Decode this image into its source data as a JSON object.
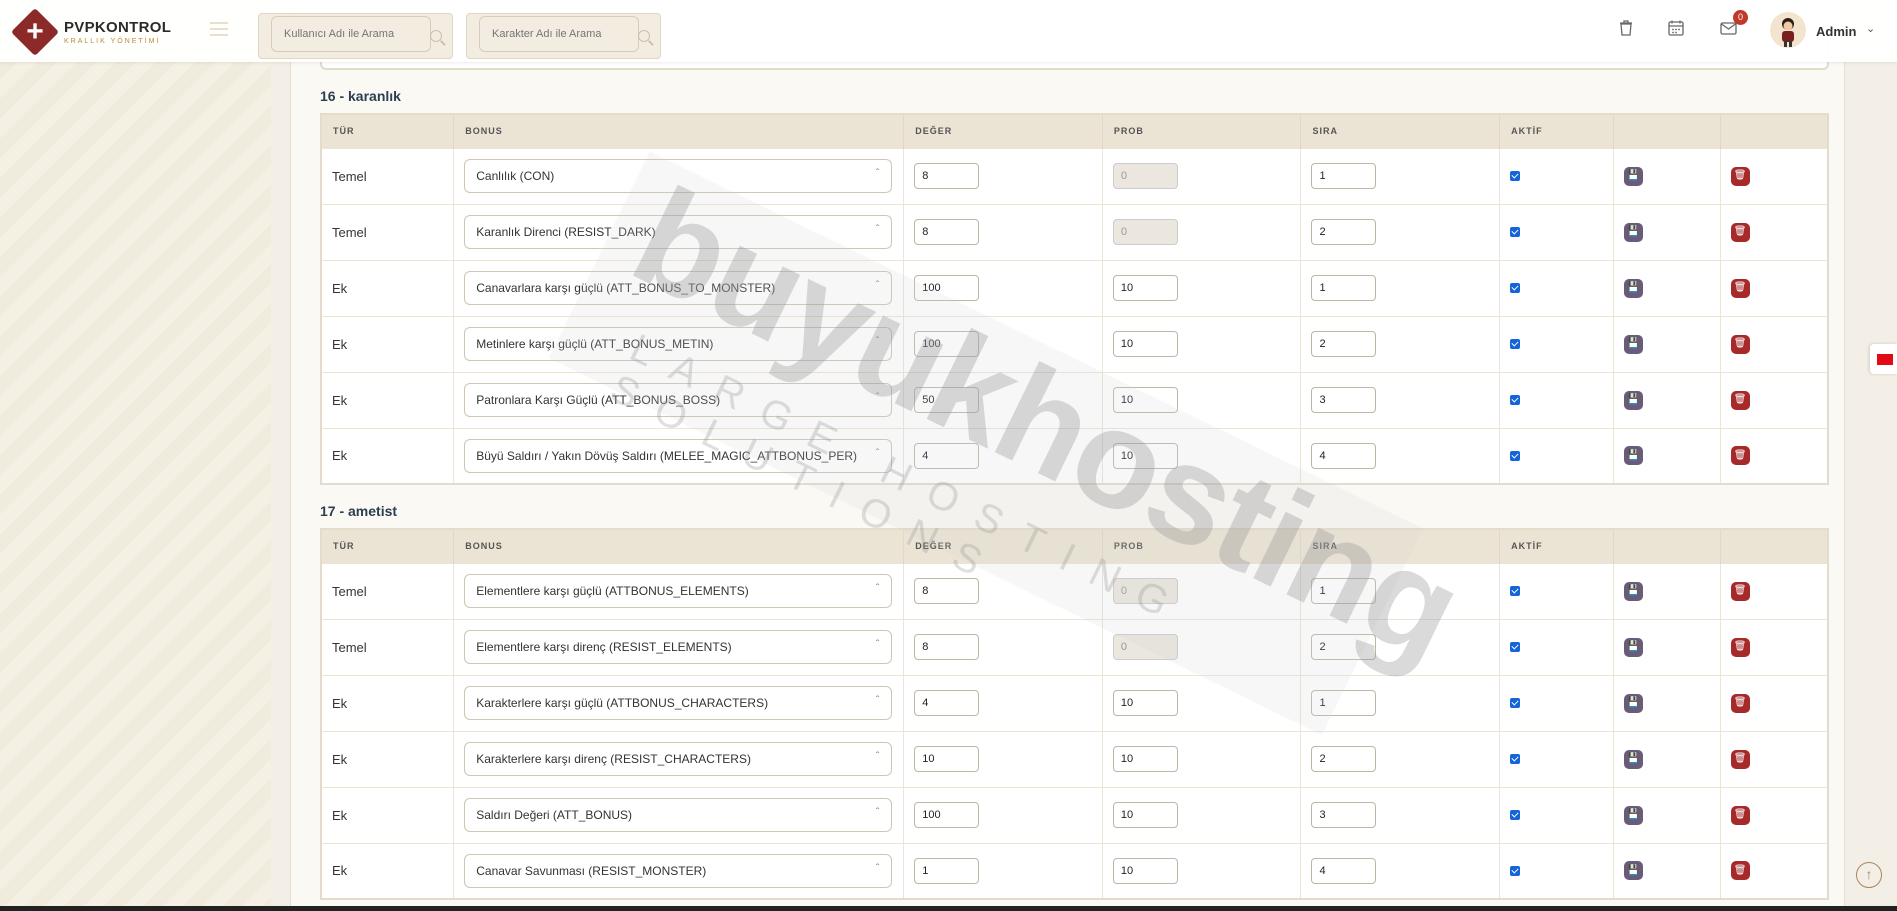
{
  "header": {
    "logo_title": "PVPKONTROL",
    "logo_subtitle": "KRALLIK YÖNETİMİ",
    "search_user_placeholder": "Kullanıcı Adı ile Arama",
    "search_char_placeholder": "Karakter Adı ile Arama",
    "mail_badge": "0",
    "user_name": "Admin"
  },
  "columns": {
    "type": "TÜR",
    "bonus": "BONUS",
    "value": "DEĞER",
    "prob": "PROB",
    "order": "SIRA",
    "active": "AKTİF"
  },
  "sections": [
    {
      "title": "16 - karanlık",
      "rows": [
        {
          "type": "Temel",
          "bonus": "Canlılık (CON)",
          "value": "8",
          "prob": "0",
          "prob_disabled": true,
          "order": "1"
        },
        {
          "type": "Temel",
          "bonus": "Karanlık Direnci (RESIST_DARK)",
          "value": "8",
          "prob": "0",
          "prob_disabled": true,
          "order": "2"
        },
        {
          "type": "Ek",
          "bonus": "Canavarlara karşı güçlü (ATT_BONUS_TO_MONSTER)",
          "value": "100",
          "prob": "10",
          "prob_disabled": false,
          "order": "1"
        },
        {
          "type": "Ek",
          "bonus": "Metinlere karşı güçlü (ATT_BONUS_METIN)",
          "value": "100",
          "prob": "10",
          "prob_disabled": false,
          "order": "2"
        },
        {
          "type": "Ek",
          "bonus": "Patronlara Karşı Güçlü (ATT_BONUS_BOSS)",
          "value": "50",
          "prob": "10",
          "prob_disabled": false,
          "order": "3"
        },
        {
          "type": "Ek",
          "bonus": "Büyü Saldırı / Yakın Dövüş Saldırı (MELEE_MAGIC_ATTBONUS_PER)",
          "value": "4",
          "prob": "10",
          "prob_disabled": false,
          "order": "4"
        }
      ]
    },
    {
      "title": "17 - ametist",
      "rows": [
        {
          "type": "Temel",
          "bonus": "Elementlere karşı güçlü (ATTBONUS_ELEMENTS)",
          "value": "8",
          "prob": "0",
          "prob_disabled": true,
          "order": "1"
        },
        {
          "type": "Temel",
          "bonus": "Elementlere karşı direnç (RESIST_ELEMENTS)",
          "value": "8",
          "prob": "0",
          "prob_disabled": true,
          "order": "2"
        },
        {
          "type": "Ek",
          "bonus": "Karakterlere karşı güçlü (ATTBONUS_CHARACTERS)",
          "value": "4",
          "prob": "10",
          "prob_disabled": false,
          "order": "1"
        },
        {
          "type": "Ek",
          "bonus": "Karakterlere karşı direnç (RESIST_CHARACTERS)",
          "value": "10",
          "prob": "10",
          "prob_disabled": false,
          "order": "2"
        },
        {
          "type": "Ek",
          "bonus": "Saldırı Değeri (ATT_BONUS)",
          "value": "100",
          "prob": "10",
          "prob_disabled": false,
          "order": "3"
        },
        {
          "type": "Ek",
          "bonus": "Canavar Savunması (RESIST_MONSTER)",
          "value": "1",
          "prob": "10",
          "prob_disabled": false,
          "order": "4"
        }
      ]
    }
  ],
  "watermark": {
    "main": "buyukhosting",
    "sub": "LARGE HOSTING SOLUTIONS"
  }
}
